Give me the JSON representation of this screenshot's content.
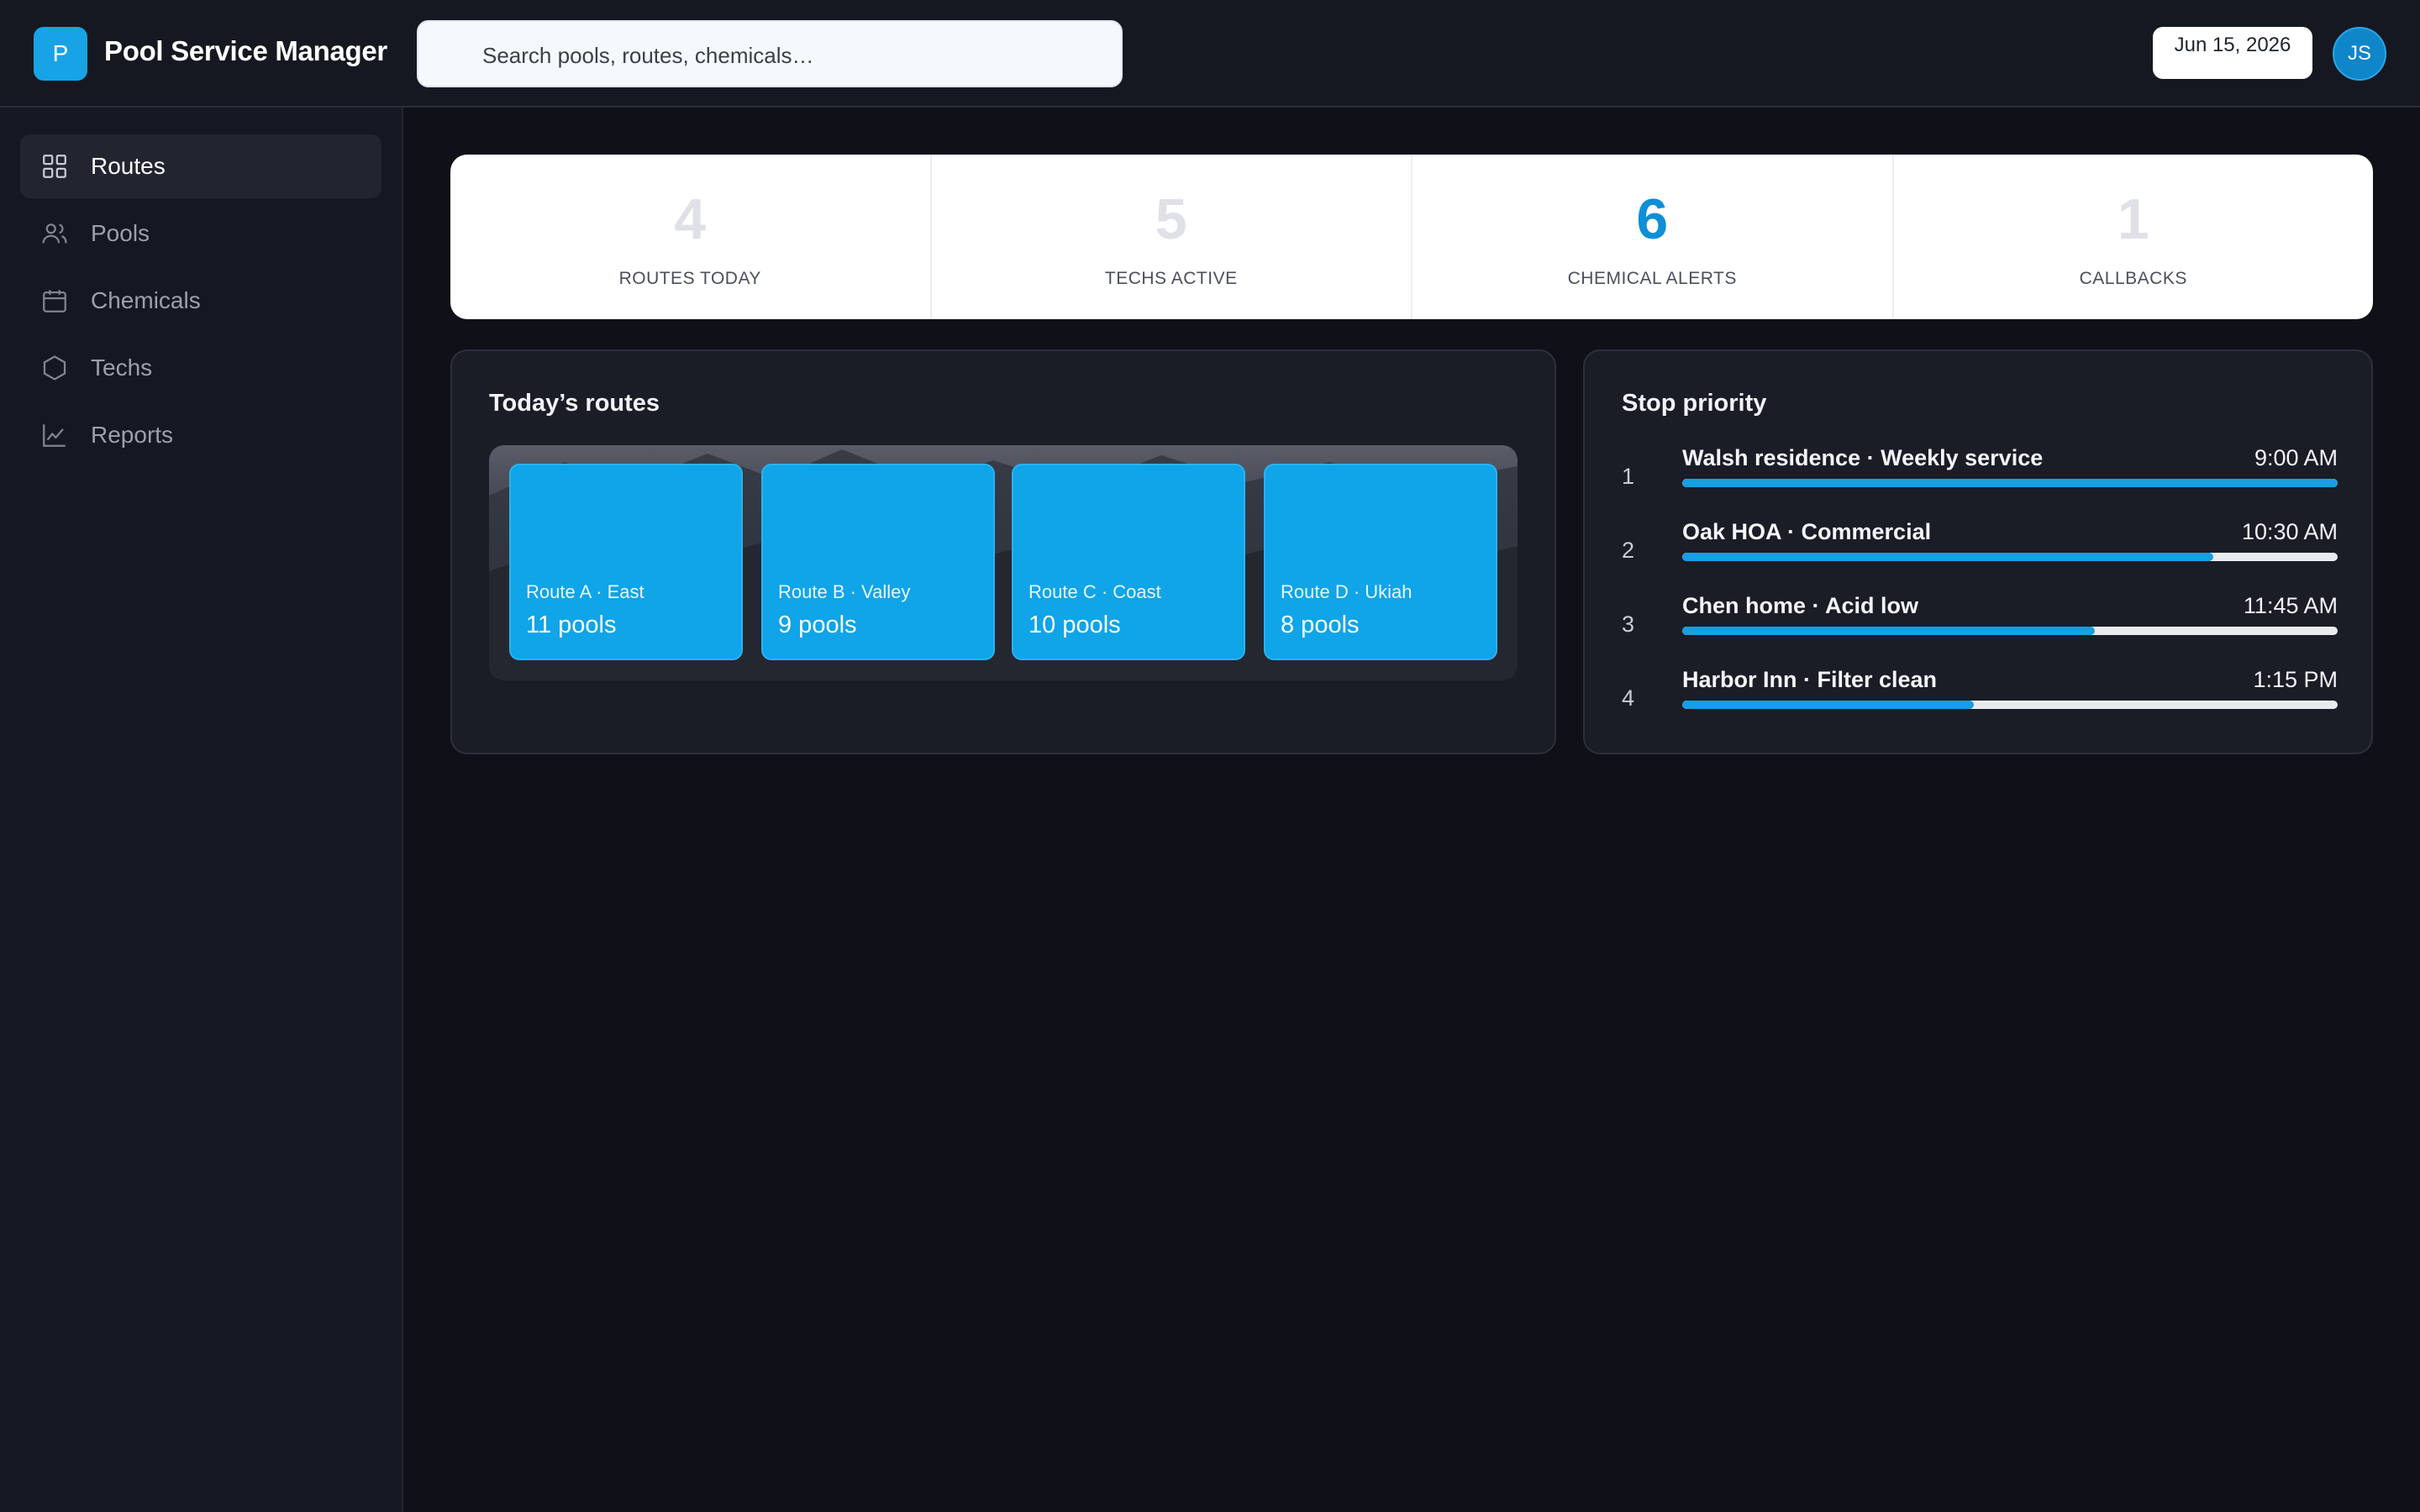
{
  "app": {
    "logo_letter": "P",
    "title": "Pool Service Manager"
  },
  "search": {
    "placeholder": "Search pools, routes, chemicals…"
  },
  "header": {
    "date": "Jun 15, 2026",
    "avatar_initials": "JS"
  },
  "sidebar": {
    "items": [
      {
        "label": "Routes",
        "icon": "grid-icon",
        "active": true
      },
      {
        "label": "Pools",
        "icon": "users-icon",
        "active": false
      },
      {
        "label": "Chemicals",
        "icon": "calendar-icon",
        "active": false
      },
      {
        "label": "Techs",
        "icon": "hexagon-icon",
        "active": false
      },
      {
        "label": "Reports",
        "icon": "line-chart-icon",
        "active": false
      }
    ]
  },
  "stats": [
    {
      "value": "4",
      "label": "ROUTES TODAY"
    },
    {
      "value": "5",
      "label": "TECHS ACTIVE"
    },
    {
      "value": "6",
      "label": "CHEMICAL ALERTS"
    },
    {
      "value": "1",
      "label": "CALLBACKS"
    }
  ],
  "routes_panel": {
    "title": "Today’s routes",
    "routes": [
      {
        "name": "Route A · East",
        "count": "11 pools"
      },
      {
        "name": "Route B · Valley",
        "count": "9 pools"
      },
      {
        "name": "Route C · Coast",
        "count": "10 pools"
      },
      {
        "name": "Route D · Ukiah",
        "count": "8 pools"
      }
    ]
  },
  "priority_panel": {
    "title": "Stop priority",
    "stops": [
      {
        "index": "1",
        "name": "Walsh residence · Weekly service",
        "time": "9:00 AM",
        "progress": 1.0
      },
      {
        "index": "2",
        "name": "Oak HOA · Commercial",
        "time": "10:30 AM",
        "progress": 0.81
      },
      {
        "index": "3",
        "name": "Chen home · Acid low",
        "time": "11:45 AM",
        "progress": 0.63
      },
      {
        "index": "4",
        "name": "Harbor Inn · Filter clean",
        "time": "1:15 PM",
        "progress": 0.445
      }
    ]
  },
  "colors": {
    "accent": "#10a4e8",
    "background": "#101118",
    "panel": "#1a1c26"
  }
}
